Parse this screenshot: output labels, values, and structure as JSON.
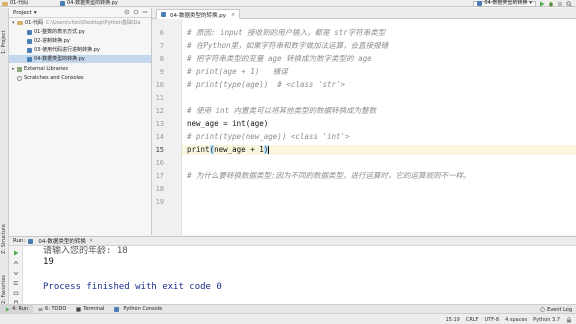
{
  "navbar": {
    "project": "01-代码",
    "file": "04-数据类型的转换.py",
    "run_config": "04-数据类型的转换"
  },
  "side_tabs": {
    "project": "1: Project",
    "structure": "Z: Structure",
    "favorites": "2: Favorites"
  },
  "project_panel": {
    "title": "Project",
    "root": {
      "name": "01-代码",
      "path": "C:\\Users\\chini\\Desktop\\Python基础\\Da"
    },
    "files": [
      "01-整数的表示方式.py",
      "02-进制转换.py",
      "03-使用代码进行进制转换.py",
      "04-数据类型的转换.py"
    ],
    "external": "External Libraries",
    "scratches": "Scratches and Consoles"
  },
  "editor": {
    "tab": "04-数据类型的转换.py",
    "lines": [
      {
        "n": "6",
        "text": "# 原因: input 接收到的用户输入，都是 str字符串类型",
        "comment": true
      },
      {
        "n": "7",
        "text": "# 在Python里，如果字符串和数字做加法运算，会直接报错",
        "comment": true
      },
      {
        "n": "8",
        "text": "# 把字符串类型的变量 age 转换成为数字类型的 age",
        "comment": true
      },
      {
        "n": "9",
        "text": "# print(age + 1)   错误",
        "comment": true
      },
      {
        "n": "10",
        "text": "# print(type(age))  # <class 'str'>",
        "comment": true
      },
      {
        "n": "11",
        "text": "",
        "comment": false
      },
      {
        "n": "12",
        "text": "# 使用 int 内置类可以将其他类型的数据转换成为整数",
        "comment": true
      },
      {
        "n": "13",
        "text": "new_age = int(age)",
        "comment": false
      },
      {
        "n": "14",
        "text": "# print(type(new_age)) <class 'int'>",
        "comment": true
      },
      {
        "n": "15",
        "text": "",
        "comment": false
      },
      {
        "n": "16",
        "text": "",
        "comment": false
      },
      {
        "n": "17",
        "text": "# 为什么要转换数据类型:因为不同的数据类型，进行运算时，它的运算规则不一样。",
        "comment": true
      },
      {
        "n": "18",
        "text": "",
        "comment": false
      },
      {
        "n": "19",
        "text": "",
        "comment": false
      }
    ],
    "current": {
      "before": "print",
      "open": "(",
      "middle": "new_age + 1",
      "close": ")"
    }
  },
  "run_panel": {
    "label": "Run:",
    "config": "04-数据类型的转换",
    "output_cut": "请输入您的年龄: 18",
    "output": "19",
    "exit": "Process finished with exit code 0"
  },
  "bottom_tabs": {
    "run": "4: Run",
    "todo": "6: TODO",
    "terminal": "Terminal",
    "python_console": "Python Console",
    "event_log": "Event Log"
  },
  "status": {
    "position": "15:19",
    "line_sep": "CRLF",
    "encoding": "UTF-8",
    "indent": "4 spaces",
    "interpreter": "Python 3.7"
  },
  "colors": {
    "comment": "#8c8c8c",
    "selection": "#c4d7ec",
    "current_line": "#fbf7df",
    "exit_text": "#1a2f8c"
  }
}
